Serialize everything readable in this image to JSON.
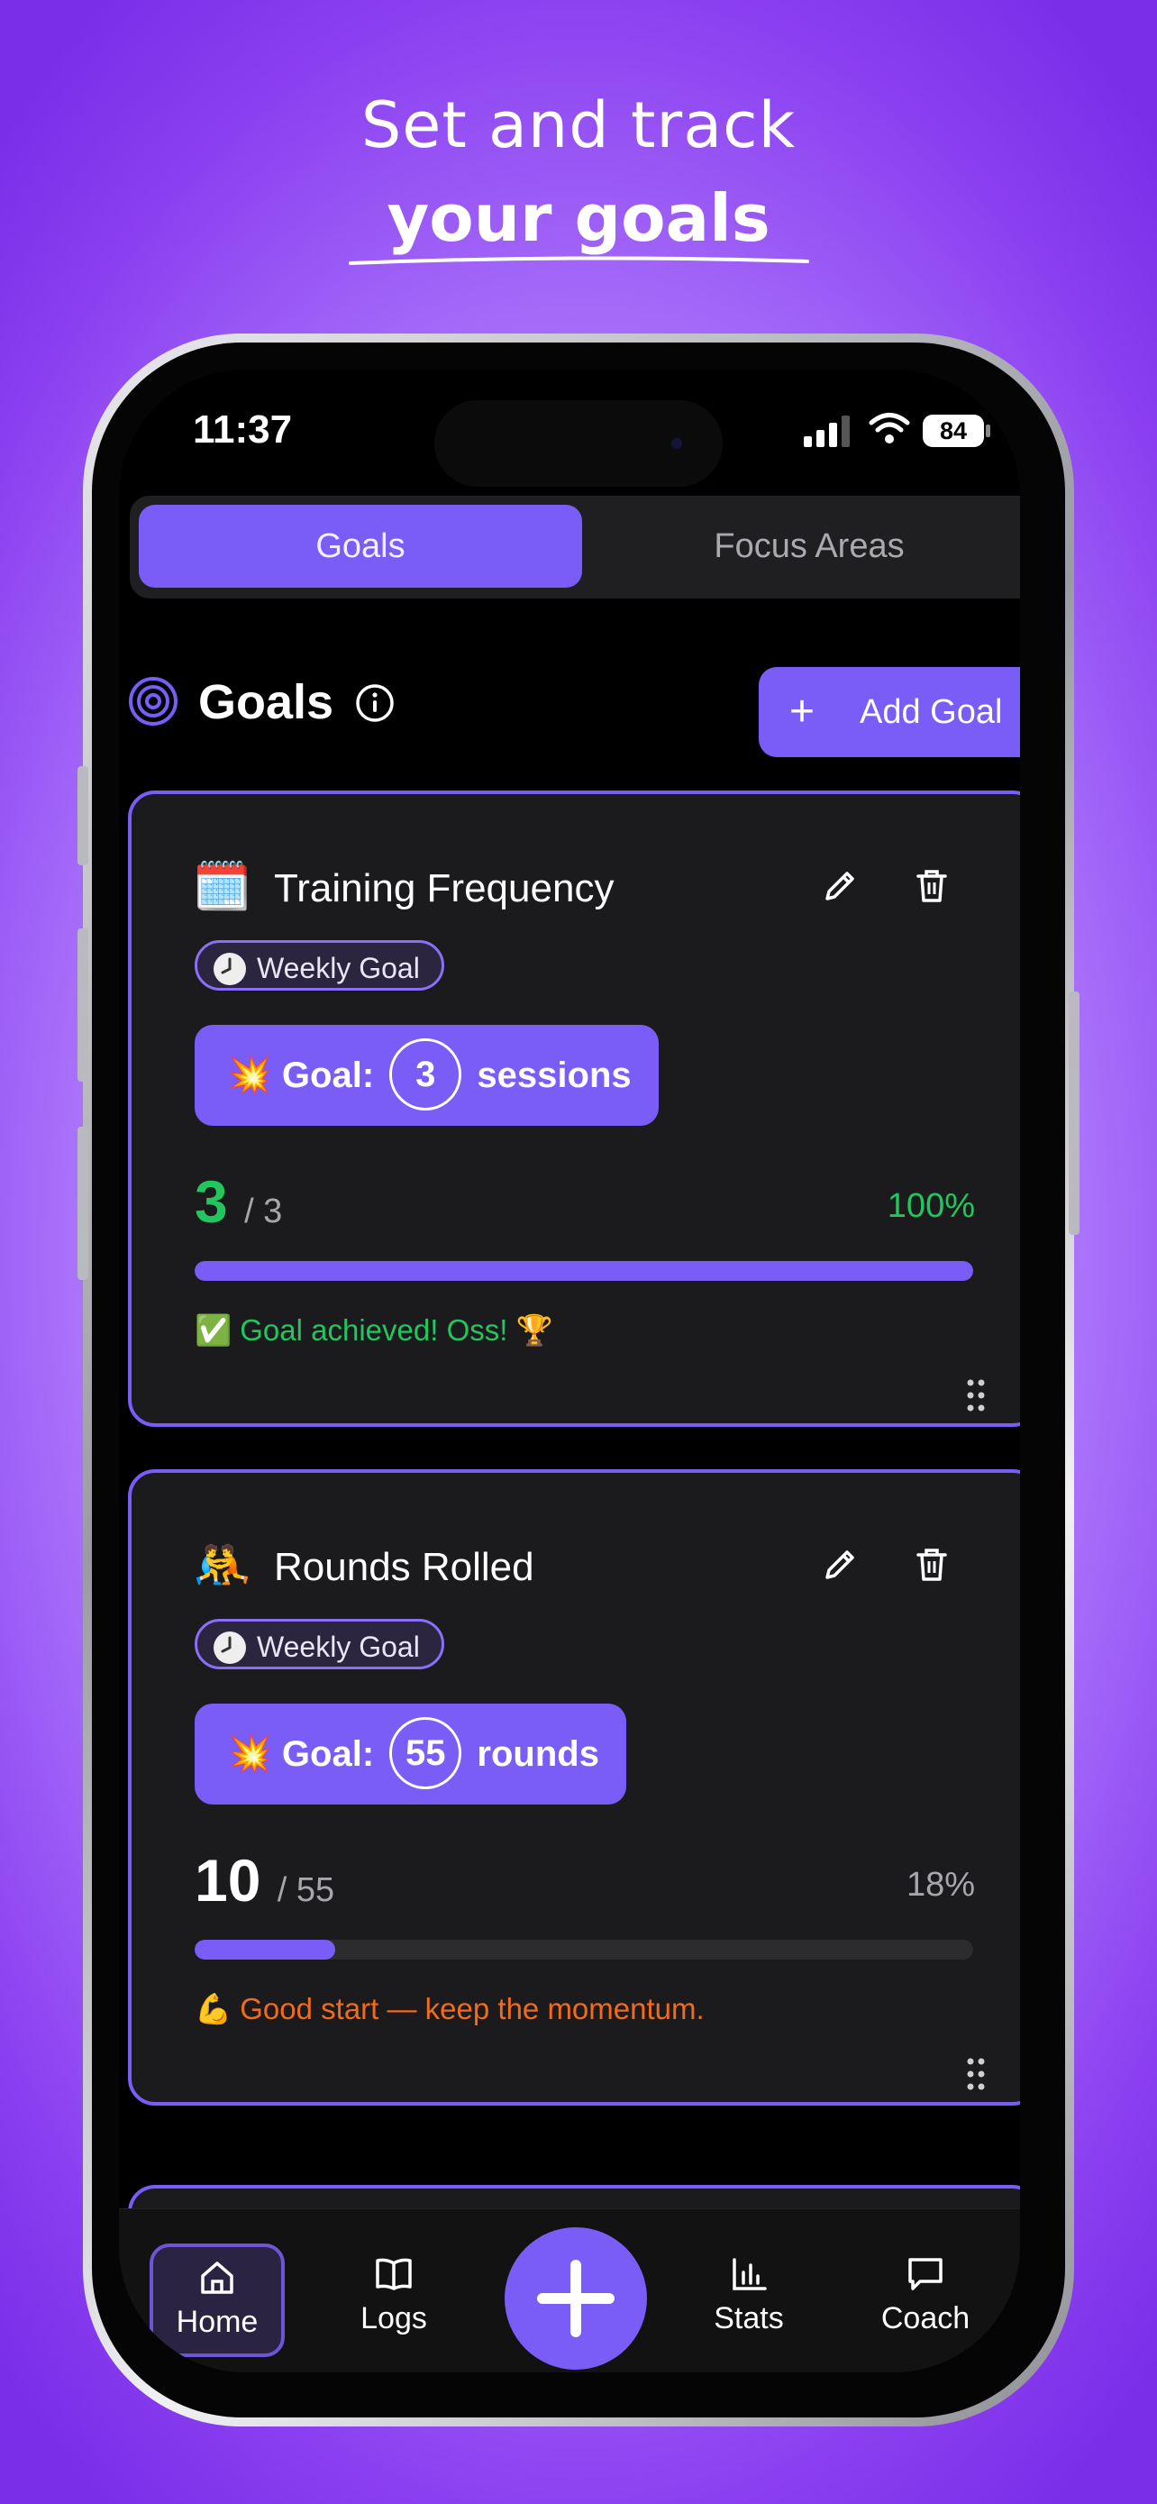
{
  "headline": {
    "line1": "Set and track",
    "line2": "your goals"
  },
  "status_bar": {
    "time": "11:37",
    "battery": "84"
  },
  "segmented": {
    "tabs": [
      {
        "label": "Goals",
        "active": true
      },
      {
        "label": "Focus Areas",
        "active": false
      }
    ]
  },
  "goals_header": {
    "title": "Goals",
    "add_button": {
      "icon": "+",
      "label": "Add Goal"
    }
  },
  "goals": [
    {
      "emoji": "🗓️",
      "title": "Training Frequency",
      "type": "Weekly Goal",
      "goal_prefix": "💥 Goal:",
      "goal_target": "3",
      "goal_unit": "sessions",
      "current": "3",
      "of_label": "/ 3",
      "percent_label": "100%",
      "progress": 1.0,
      "message": "✅ Goal achieved! Oss! 🏆",
      "current_color": "#22c55e",
      "message_color": "#22c55e"
    },
    {
      "emoji": "🤼",
      "title": "Rounds Rolled",
      "type": "Weekly Goal",
      "goal_prefix": "💥 Goal:",
      "goal_target": "55",
      "goal_unit": "rounds",
      "current": "10",
      "of_label": "/ 55",
      "percent_label": "18%",
      "progress": 0.18,
      "message": "💪 Good start — keep the momentum.",
      "current_color": "#ffffff",
      "message_color": "#f26a1b"
    }
  ],
  "tabbar": {
    "items": [
      {
        "label": "Home",
        "icon": "home-icon",
        "active": true
      },
      {
        "label": "Logs",
        "icon": "book-icon",
        "active": false
      },
      {
        "label": "Stats",
        "icon": "bar-chart-icon",
        "active": false
      },
      {
        "label": "Coach",
        "icon": "chat-bubble-icon",
        "active": false
      }
    ],
    "fab_icon": "plus-icon"
  },
  "colors": {
    "accent": "#7a5cf6",
    "success": "#22c55e",
    "warning": "#f26a1b",
    "card_bg": "#1b1b1d"
  }
}
